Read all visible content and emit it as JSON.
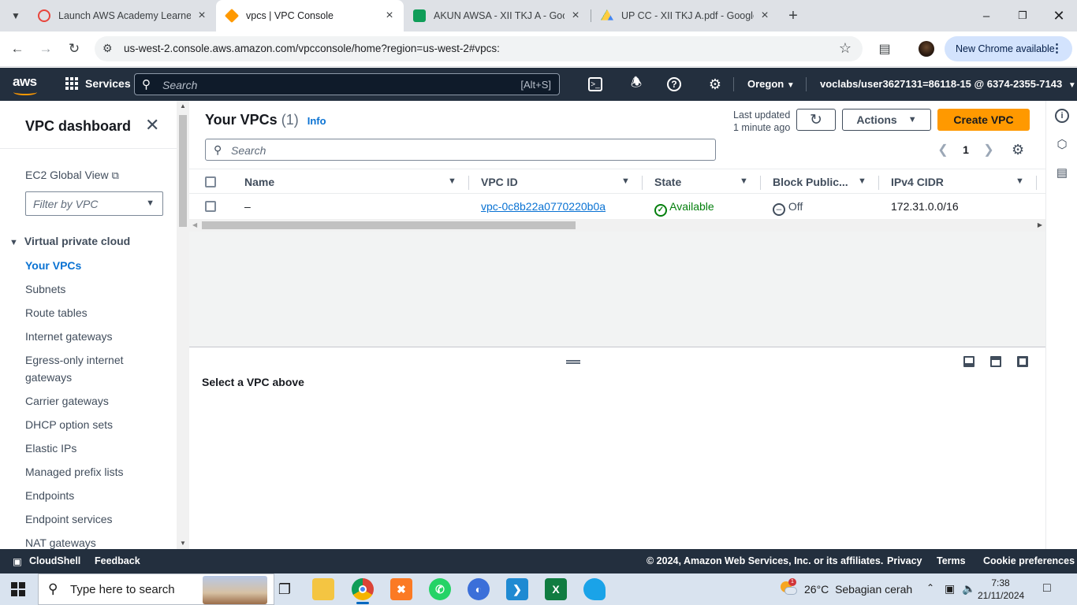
{
  "browser": {
    "tabs": [
      {
        "title": "Launch AWS Academy Learner L",
        "icon_color": "#e8453c"
      },
      {
        "title": "vpcs | VPC Console",
        "icon_color": "#ff9900"
      },
      {
        "title": "AKUN AWSA - XII TKJ A - Goog",
        "icon_color": "#0f9d58"
      },
      {
        "title": "UP CC - XII TKJ A.pdf - Google D",
        "icon_color": "#4285f4"
      }
    ],
    "url": "us-west-2.console.aws.amazon.com/vpcconsole/home?region=us-west-2#vpcs:",
    "new_chrome_label": "New Chrome available"
  },
  "awsnav": {
    "logo": "aws",
    "services_label": "Services",
    "search_placeholder": "Search",
    "search_shortcut": "[Alt+S]",
    "region": "Oregon",
    "account": "voclabs/user3627131=86118-15 @ 6374-2355-7143"
  },
  "sidebar": {
    "title": "VPC dashboard",
    "ec2_global_view": "EC2 Global View",
    "filter_placeholder": "Filter by VPC",
    "section_title": "Virtual private cloud",
    "items": [
      {
        "label": "Your VPCs",
        "active": true
      },
      {
        "label": "Subnets"
      },
      {
        "label": "Route tables"
      },
      {
        "label": "Internet gateways"
      },
      {
        "label": "Egress-only internet gateways"
      },
      {
        "label": "Carrier gateways"
      },
      {
        "label": "DHCP option sets"
      },
      {
        "label": "Elastic IPs"
      },
      {
        "label": "Managed prefix lists"
      },
      {
        "label": "Endpoints"
      },
      {
        "label": "Endpoint services"
      },
      {
        "label": "NAT gateways"
      }
    ]
  },
  "main": {
    "title": "Your VPCs",
    "count": "(1)",
    "info_label": "Info",
    "last_updated_label": "Last updated",
    "last_updated_value": "1 minute ago",
    "actions_label": "Actions",
    "create_label": "Create VPC",
    "search_placeholder": "Search",
    "page_number": "1",
    "columns": [
      "Name",
      "VPC ID",
      "State",
      "Block Public...",
      "IPv4 CIDR"
    ],
    "rows": [
      {
        "name": "–",
        "vpc_id": "vpc-0c8b22a0770220b0a",
        "state": "Available",
        "block_public": "Off",
        "ipv4_cidr": "172.31.0.0/16"
      }
    ],
    "detail_placeholder": "Select a VPC above"
  },
  "footer": {
    "cloudshell": "CloudShell",
    "feedback": "Feedback",
    "copyright": "© 2024, Amazon Web Services, Inc. or its affiliates.",
    "privacy": "Privacy",
    "terms": "Terms",
    "cookie": "Cookie preferences"
  },
  "taskbar": {
    "search_placeholder": "Type here to search",
    "weather_temp": "26°C",
    "weather_desc": "Sebagian cerah",
    "weather_badge": "1",
    "time": "7:38",
    "date": "21/11/2024"
  }
}
